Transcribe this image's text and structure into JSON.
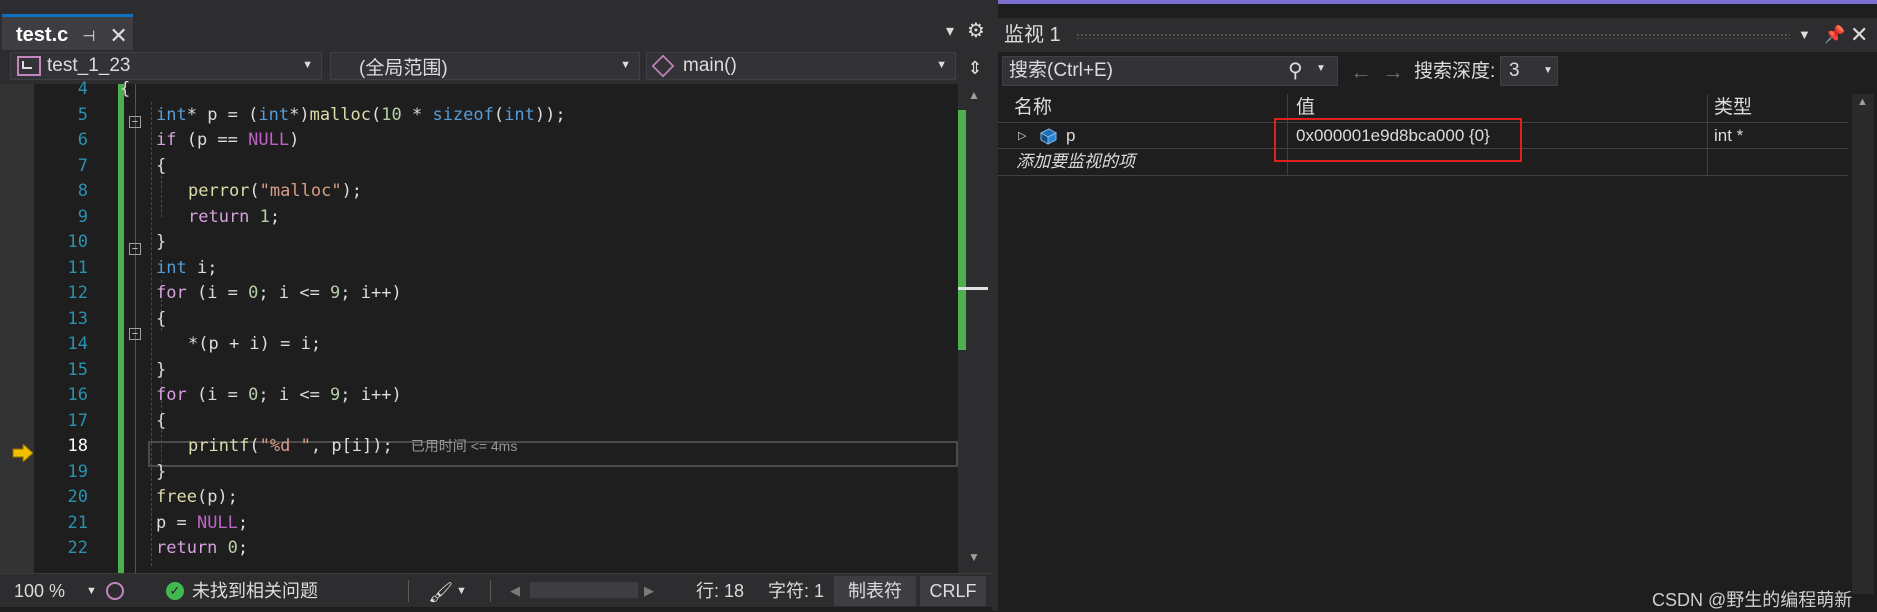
{
  "editor": {
    "tab": {
      "title": "test.c",
      "pin_glyph": "⊣",
      "close_glyph": "✕"
    },
    "nav": {
      "project": "test_1_23",
      "scope": "(全局范围)",
      "member": "main()"
    },
    "lines": [
      {
        "n": "4"
      },
      {
        "n": "5"
      },
      {
        "n": "6"
      },
      {
        "n": "7"
      },
      {
        "n": "8"
      },
      {
        "n": "9"
      },
      {
        "n": "10"
      },
      {
        "n": "11"
      },
      {
        "n": "12"
      },
      {
        "n": "13"
      },
      {
        "n": "14"
      },
      {
        "n": "15"
      },
      {
        "n": "16"
      },
      {
        "n": "17"
      },
      {
        "n": "18"
      },
      {
        "n": "19"
      },
      {
        "n": "20"
      },
      {
        "n": "21"
      },
      {
        "n": "22"
      }
    ],
    "code": {
      "l4": "{",
      "l5": {
        "t1": "int",
        "t2": "* p = (",
        "t3": "int",
        "t4": "*)",
        "t5": "malloc",
        "t6": "(",
        "t7": "10",
        "t8": " * ",
        "t9": "sizeof",
        "t10": "(",
        "t11": "int",
        "t12": "));"
      },
      "l6": {
        "t1": "if",
        "t2": " (p == ",
        "t3": "NULL",
        "t4": ")"
      },
      "l7": "{",
      "l8": {
        "t1": "perror",
        "t2": "(",
        "t3": "\"malloc\"",
        "t4": ");"
      },
      "l9": {
        "t1": "return",
        "t2": " ",
        "t3": "1",
        "t4": ";"
      },
      "l10": "}",
      "l11": {
        "t1": "int",
        "t2": " i;"
      },
      "l12": {
        "t1": "for",
        "t2": " (i = ",
        "t3": "0",
        "t4": "; i <= ",
        "t5": "9",
        "t6": "; i++)"
      },
      "l13": "{",
      "l14": "*(p + i) = i;",
      "l15": "}",
      "l16": {
        "t1": "for",
        "t2": " (i = ",
        "t3": "0",
        "t4": "; i <= ",
        "t5": "9",
        "t6": "; i++)"
      },
      "l17": "{",
      "l18": {
        "t1": "printf",
        "t2": "(",
        "t3": "\"%d \"",
        "t4": ", p[i]);"
      },
      "l19": "}",
      "l20": {
        "t1": "free",
        "t2": "(p);"
      },
      "l21": {
        "t1": "p = ",
        "t2": "NULL",
        "t3": ";"
      },
      "l22": {
        "t1": "return",
        "t2": " ",
        "t3": "0",
        "t4": ";"
      }
    },
    "perf_tip": "已用时间 <= 4ms",
    "current_line": "18"
  },
  "status": {
    "zoom": "100 %",
    "issues": "未找到相关问题",
    "line": "行: 18",
    "char": "字符: 1",
    "tab_mode": "制表符",
    "eol": "CRLF"
  },
  "watch": {
    "title": "监视 1",
    "search_placeholder": "搜索(Ctrl+E)",
    "depth_label": "搜索深度:",
    "depth_value": "3",
    "columns": {
      "name": "名称",
      "value": "值",
      "type": "类型"
    },
    "rows": [
      {
        "name": "p",
        "value": "0x000001e9d8bca000 {0}",
        "type": "int *"
      }
    ],
    "add_item": "添加要监视的项"
  },
  "watermark": "CSDN @野生的编程萌新",
  "colors": {
    "accent_tab": "#0e70c0",
    "change_bar": "#4caf50",
    "highlight_box": "#e02020",
    "watch_accent": "#7b6fd0"
  },
  "icons": {
    "current_statement": "yellow-arrow-icon",
    "ok": "check-circle-icon",
    "search": "search-icon",
    "variable": "variable-cube-icon"
  }
}
